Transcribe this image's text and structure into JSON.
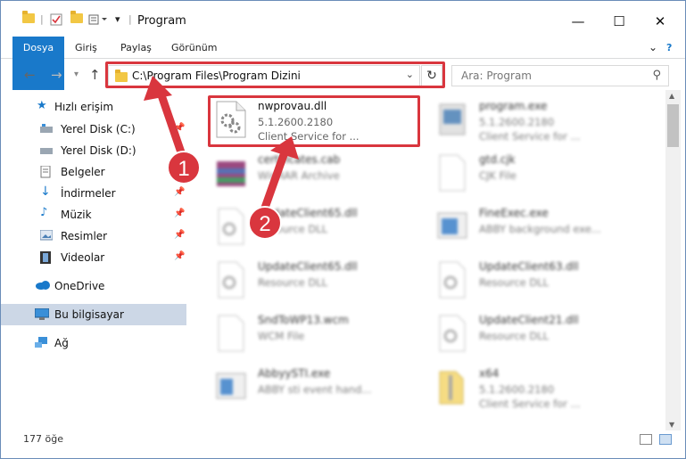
{
  "window": {
    "title": "Program",
    "minimize": "—",
    "maximize": "☐",
    "close": "✕"
  },
  "ribbon": {
    "tabs": [
      "Dosya",
      "Giriş",
      "Paylaş",
      "Görünüm"
    ]
  },
  "navigation": {
    "address": "C:\\Program Files\\Program Dizini",
    "search_placeholder": "Ara: Program"
  },
  "sidebar": {
    "items": [
      {
        "label": "Hızlı erişim",
        "icon": "star-icon",
        "pinned": false
      },
      {
        "label": "Yerel Disk (C:)",
        "icon": "drive-icon",
        "pinned": true
      },
      {
        "label": "Yerel Disk (D:)",
        "icon": "drive-icon",
        "pinned": false
      },
      {
        "label": "Belgeler",
        "icon": "documents-icon",
        "pinned": true
      },
      {
        "label": "İndirmeler",
        "icon": "download-icon",
        "pinned": true
      },
      {
        "label": "Müzik",
        "icon": "music-icon",
        "pinned": true
      },
      {
        "label": "Resimler",
        "icon": "pictures-icon",
        "pinned": true
      },
      {
        "label": "Videolar",
        "icon": "videos-icon",
        "pinned": true
      },
      {
        "label": "OneDrive",
        "icon": "cloud-icon",
        "pinned": false
      },
      {
        "label": "Bu bilgisayar",
        "icon": "computer-icon",
        "pinned": false,
        "selected": true
      },
      {
        "label": "Ağ",
        "icon": "network-icon",
        "pinned": false
      }
    ]
  },
  "files": [
    {
      "name": "nwprovau.dll",
      "line2": "5.1.2600.2180",
      "line3": "Client Service for ...",
      "highlighted": true
    },
    {
      "name": "program.exe",
      "line2": "5.1.2600.2180",
      "line3": "Client Service for ..."
    },
    {
      "name": "certificates.cab",
      "line2": "WinRAR Archive",
      "line3": ""
    },
    {
      "name": "gtd.cjk",
      "line2": "CJK File",
      "line3": ""
    },
    {
      "name": "UpdateClient65.dll",
      "line2": "Resource DLL",
      "line3": ""
    },
    {
      "name": "FineExec.exe",
      "line2": "ABBY background exe...",
      "line3": ""
    },
    {
      "name": "UpdateClient65.dll",
      "line2": "Resource DLL",
      "line3": ""
    },
    {
      "name": "UpdateClient63.dll",
      "line2": "Resource DLL",
      "line3": ""
    },
    {
      "name": "SndToWP13.wcm",
      "line2": "WCM File",
      "line3": ""
    },
    {
      "name": "UpdateClient21.dll",
      "line2": "Resource DLL",
      "line3": ""
    },
    {
      "name": "AbbyySTI.exe",
      "line2": "ABBY sti event hand...",
      "line3": ""
    },
    {
      "name": "x64",
      "line2": "5.1.2600.2180",
      "line3": "Client Service for ..."
    }
  ],
  "status": {
    "count": "177 öğe"
  },
  "annotations": [
    "1",
    "2"
  ],
  "colors": {
    "accent": "#1979ca",
    "highlight_red": "#d9363e",
    "selected_bg": "#ccd7e6"
  }
}
